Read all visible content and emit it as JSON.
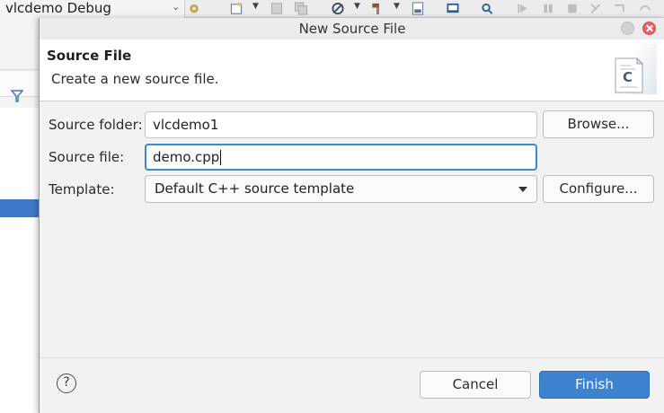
{
  "ide": {
    "launch_config": "vlcdemo Debug"
  },
  "dialog": {
    "title": "New Source File",
    "banner_title": "Source File",
    "banner_description": "Create a new source file.",
    "banner_icon_letter": "C",
    "source_folder_label": "Source folder:",
    "source_folder_value": "vlcdemo1",
    "browse_label": "Browse...",
    "source_file_label": "Source file:",
    "source_file_value": "demo.cpp",
    "template_label": "Template:",
    "template_value": "Default C++ source template",
    "configure_label": "Configure...",
    "help_label": "?",
    "cancel_label": "Cancel",
    "finish_label": "Finish"
  },
  "colors": {
    "accent": "#3d83cf",
    "focus_border": "#3c8ad6",
    "close_button": "#ec5e62"
  },
  "icons": [
    "gear-icon",
    "new-file-icon",
    "save-icon",
    "save-all-icon",
    "debug-icon",
    "build-icon",
    "binary-icon",
    "console-icon",
    "search-icon",
    "resume-icon",
    "suspend-icon",
    "terminate-icon",
    "step-icon",
    "filter-icon",
    "help-icon",
    "source-file-icon"
  ]
}
